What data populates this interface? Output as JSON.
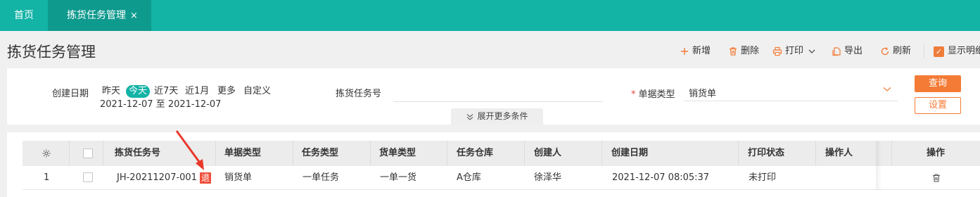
{
  "tabs": {
    "home": "首页",
    "active": "拣货任务管理",
    "close": "×"
  },
  "page": {
    "title": "拣货任务管理"
  },
  "toolbar": {
    "add": "新增",
    "delete": "删除",
    "print": "打印",
    "export": "导出",
    "refresh": "刷新",
    "show_detail": "显示明细"
  },
  "filter": {
    "date_label": "创建日期",
    "date_options": [
      "昨天",
      "今天",
      "近7天",
      "近1月",
      "更多",
      "自定义"
    ],
    "selected_option": "今天",
    "date_range": "2021-12-07 至 2021-12-07",
    "task_no_label": "拣货任务号",
    "task_no_value": "",
    "doc_type_required": "*",
    "doc_type_label": "单据类型",
    "doc_type_value": "销货单",
    "query_button": "查询",
    "setting_button": "设置",
    "expand_label": "展开更多条件"
  },
  "table": {
    "columns": [
      "拣货任务号",
      "单据类型",
      "任务类型",
      "货单类型",
      "任务仓库",
      "创建人",
      "创建日期",
      "打印状态",
      "操作人",
      "操作"
    ],
    "rows": [
      {
        "index": "1",
        "task_no": "JH-20211207-001",
        "badge": "退",
        "doc_type": "销货单",
        "task_type": "一单任务",
        "order_type": "一单一货",
        "warehouse": "A仓库",
        "creator": "徐泽华",
        "created_at": "2021-12-07 08:05:37",
        "print_status": "未打印",
        "operator": ""
      }
    ]
  },
  "colors": {
    "brand": "#13b3a6",
    "brand_dark": "#0f9a8e",
    "accent": "#f47b36",
    "badge": "#f04e3a",
    "annotation": "#e8382b"
  }
}
